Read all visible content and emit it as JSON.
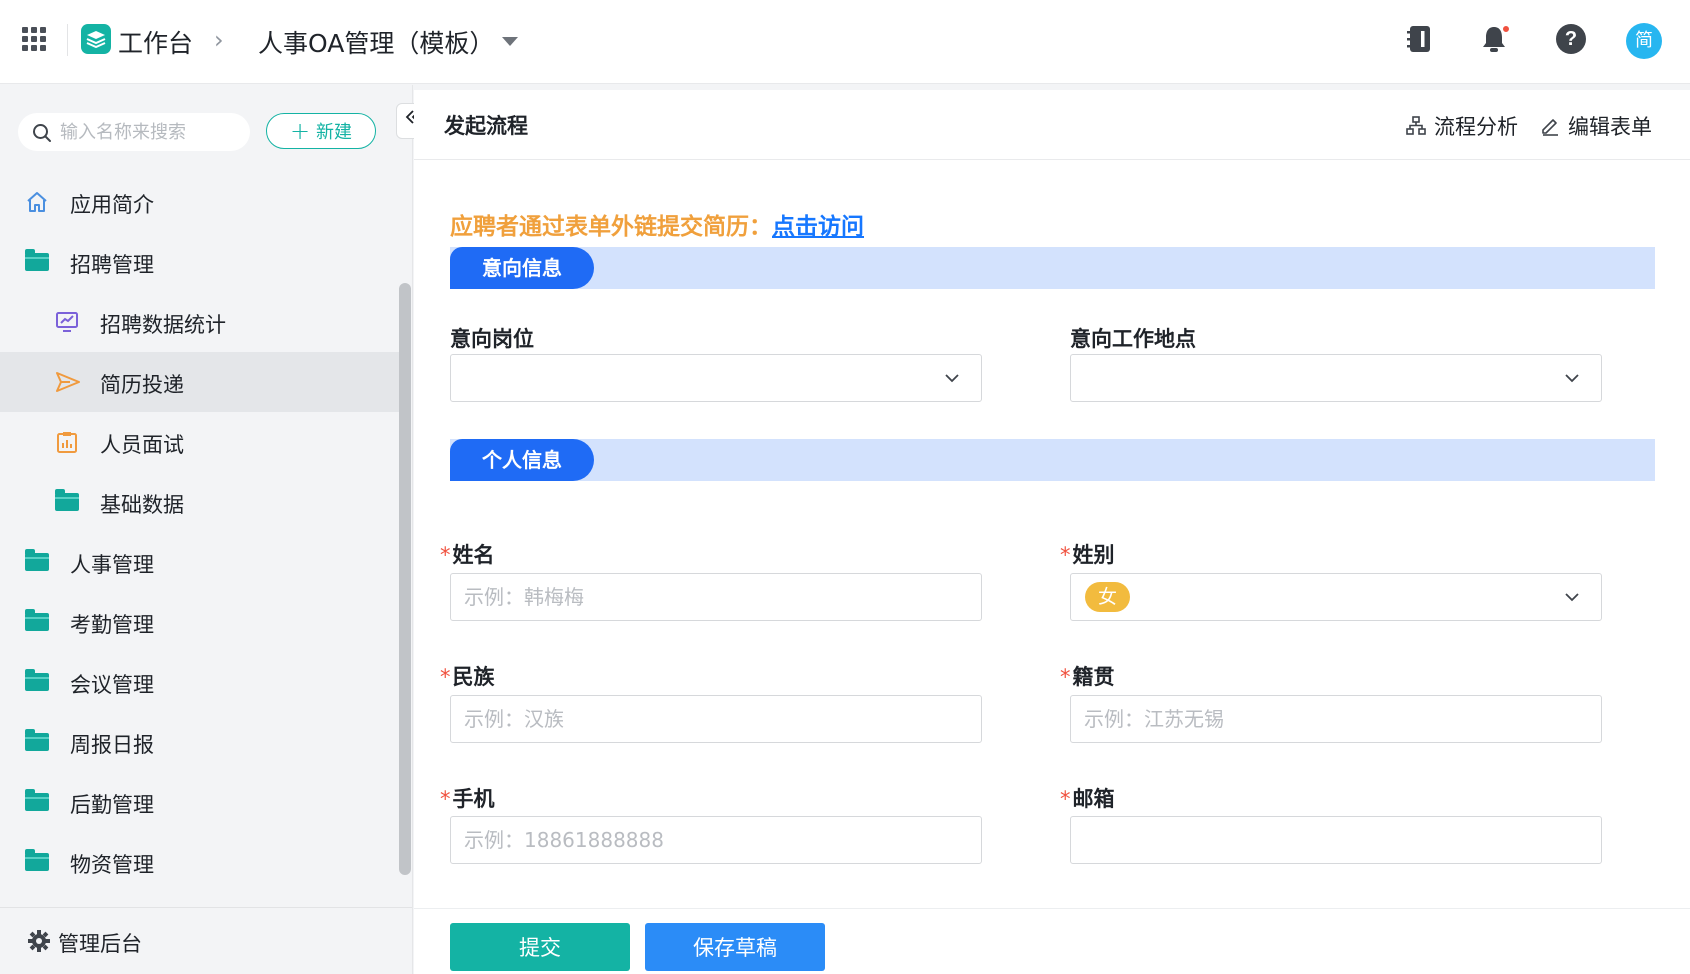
{
  "topbar": {
    "brand": "工作台",
    "crumb_sep": "›",
    "app_title": "人事OA管理（模板）",
    "avatar_text": "简",
    "help_text": "?"
  },
  "sidebar": {
    "search_placeholder": "输入名称来搜索",
    "new_label": "新建",
    "items": [
      {
        "label": "应用简介",
        "icon": "home-icon"
      },
      {
        "label": "招聘管理",
        "icon": "folder-icon"
      },
      {
        "label": "招聘数据统计",
        "icon": "monitor-chart-icon"
      },
      {
        "label": "简历投递",
        "icon": "send-icon",
        "active": true
      },
      {
        "label": "人员面试",
        "icon": "clipboard-icon"
      },
      {
        "label": "基础数据",
        "icon": "folder-icon"
      },
      {
        "label": "人事管理",
        "icon": "folder-icon"
      },
      {
        "label": "考勤管理",
        "icon": "folder-icon"
      },
      {
        "label": "会议管理",
        "icon": "folder-icon"
      },
      {
        "label": "周报日报",
        "icon": "folder-icon"
      },
      {
        "label": "后勤管理",
        "icon": "folder-icon"
      },
      {
        "label": "物资管理",
        "icon": "folder-icon"
      }
    ],
    "footer_label": "管理后台"
  },
  "main": {
    "title": "发起流程",
    "actions": {
      "analysis": "流程分析",
      "edit_form": "编辑表单"
    },
    "notice_text": "应聘者通过表单外链提交简历：",
    "notice_link": "点击访问",
    "sections": {
      "intent": "意向信息",
      "personal": "个人信息"
    },
    "fields": {
      "position": {
        "label": "意向岗位"
      },
      "location": {
        "label": "意向工作地点"
      },
      "name": {
        "label": "姓名",
        "placeholder": "示例：韩梅梅"
      },
      "gender": {
        "label": "姓别",
        "value": "女"
      },
      "ethnicity": {
        "label": "民族",
        "placeholder": "示例：汉族"
      },
      "hometown": {
        "label": "籍贯",
        "placeholder": "示例：江苏无锡"
      },
      "phone": {
        "label": "手机",
        "placeholder": "示例：18861888888"
      },
      "email": {
        "label": "邮箱"
      }
    },
    "required_mark": "*",
    "buttons": {
      "submit": "提交",
      "draft": "保存草稿"
    }
  },
  "colors": {
    "brand": "#14b3a4",
    "primary_blue": "#1f6bf5",
    "notice_orange": "#f0a03c",
    "required_red": "#f0513f",
    "chip_yellow": "#f2bb3e"
  }
}
